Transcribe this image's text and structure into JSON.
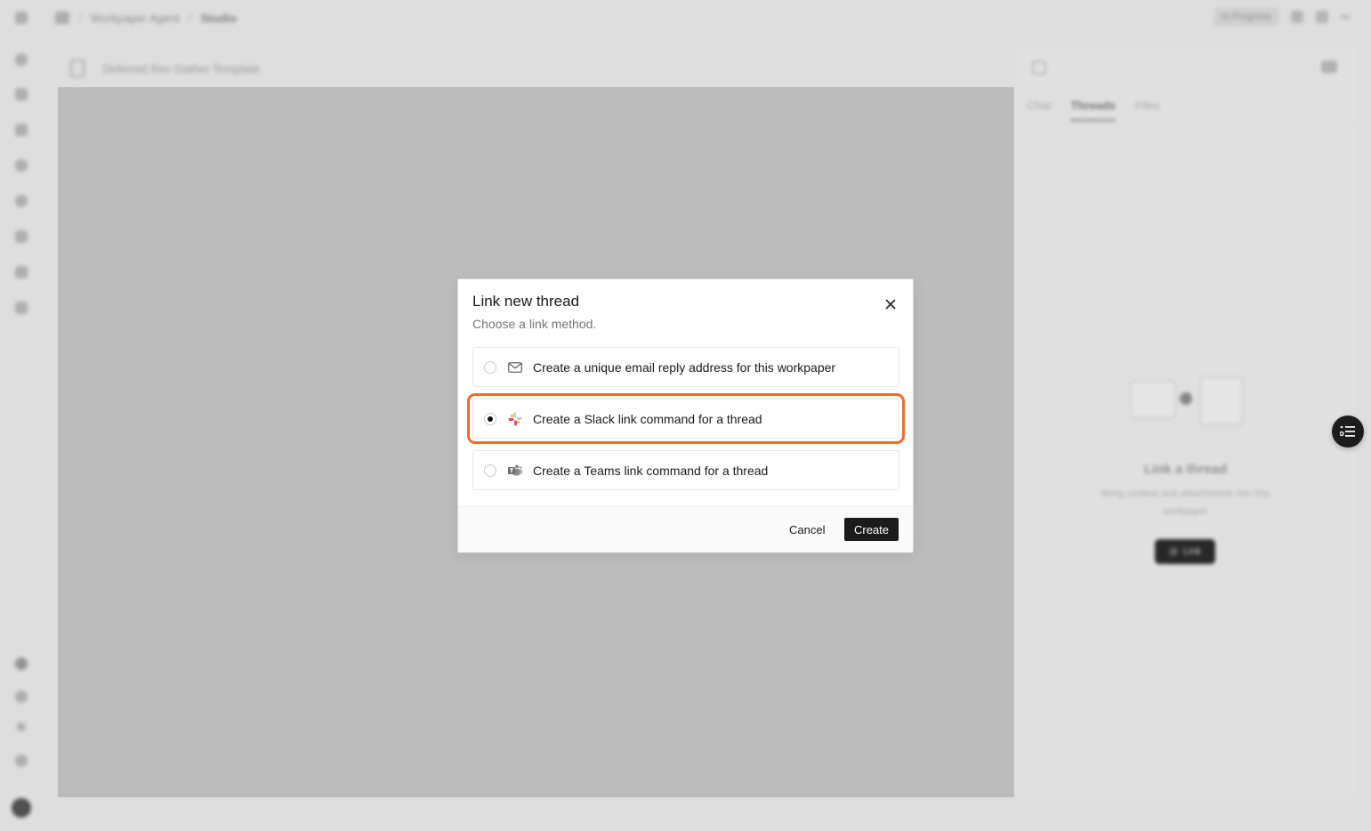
{
  "background": {
    "breadcrumbs": [
      "Workpaper Agent",
      "Studio"
    ],
    "top_badge": "In Progress",
    "document_title": "Deferred Rev Gather Template",
    "panel_tabs": [
      "Chat",
      "Threads",
      "Files"
    ],
    "panel_active_tab": "Threads",
    "empty_state_title": "Link a thread",
    "empty_state_subtitle": "Bring context and attachments into this workpaper",
    "empty_state_button": "Link"
  },
  "modal": {
    "title": "Link new thread",
    "subtitle": "Choose a link method.",
    "options": [
      {
        "label": "Create a unique email reply address for this workpaper",
        "icon": "mail-icon",
        "selected": false
      },
      {
        "label": "Create a Slack link command for a thread",
        "icon": "slack-icon",
        "selected": true
      },
      {
        "label": "Create a Teams link command for a thread",
        "icon": "teams-icon",
        "selected": false
      }
    ],
    "cancel_label": "Cancel",
    "create_label": "Create"
  },
  "colors": {
    "accent_highlight": "#f26a2e",
    "primary_button": "#1b1b1b",
    "slack_red": "#e0466a",
    "slack_yellow": "#ecb22e"
  }
}
